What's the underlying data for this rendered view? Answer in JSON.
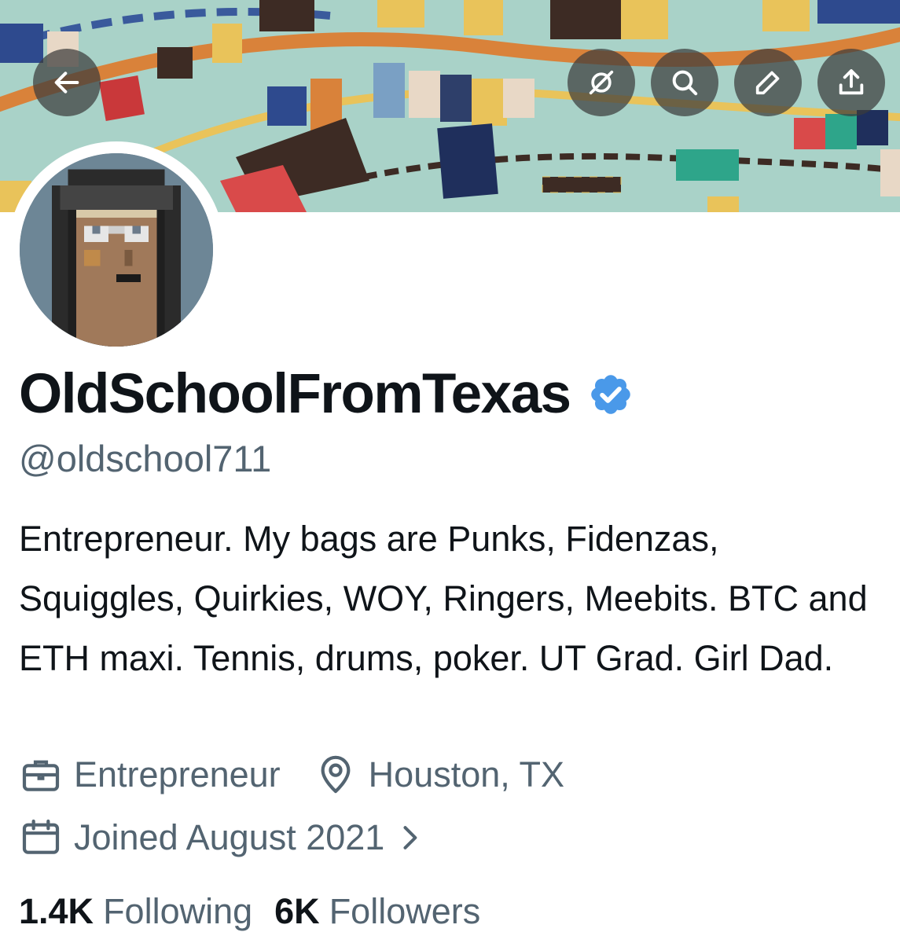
{
  "profile": {
    "display_name": "OldSchoolFromTexas",
    "handle": "@oldschool711",
    "bio": "Entrepreneur. My bags are Punks, Fidenzas, Squiggles, Quirkies, WOY, Ringers, Meebits. BTC and ETH maxi. Tennis, drums, poker. UT Grad. Girl Dad.",
    "profession": "Entrepreneur",
    "location": "Houston, TX",
    "joined": "Joined August 2021",
    "following_count": "1.4K",
    "following_label": "Following",
    "followers_count": "6K",
    "followers_label": "Followers"
  },
  "header_buttons": {
    "back": "arrow-left-icon",
    "grok": "grok-icon",
    "search": "search-icon",
    "edit": "pencil-icon",
    "share": "share-icon"
  },
  "colors": {
    "verified": "#4a99e9",
    "secondary_text": "#536471",
    "primary_text": "#0f1419",
    "banner_background": "#a9d2c8"
  }
}
